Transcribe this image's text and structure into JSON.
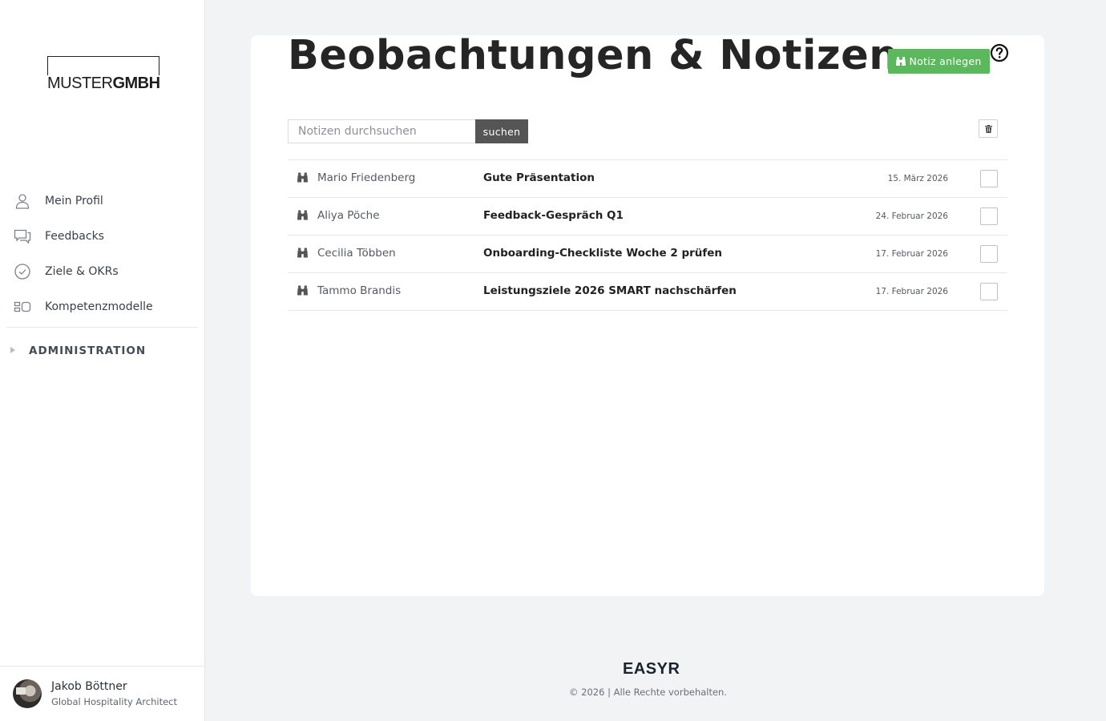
{
  "sidebar": {
    "logo": {
      "text_light": "MUSTER",
      "text_bold": "GMBH"
    },
    "items": [
      {
        "label": "Mein Profil",
        "icon": "user-icon"
      },
      {
        "label": "Feedbacks",
        "icon": "chat-bubbles-icon"
      },
      {
        "label": "Ziele & OKRs",
        "icon": "check-circle-icon"
      },
      {
        "label": "Kompetenzmodelle",
        "icon": "competency-model-icon"
      }
    ],
    "admin": {
      "label": "ADMINISTRATION",
      "icon": "caret-right-icon"
    },
    "user": {
      "name": "Jakob Böttner",
      "role": "Global Hospitality Architect"
    }
  },
  "main": {
    "title": "Beobachtungen & Notizen",
    "new_button": {
      "label": "Notiz anlegen",
      "icon": "binoculars-icon",
      "color": "#5cb85c"
    },
    "help_icon": "help-circle-icon",
    "search": {
      "placeholder": "Notizen durchsuchen",
      "value": "",
      "button_label": "suchen"
    },
    "delete_icon": "trash-icon",
    "notes": [
      {
        "author": "Mario Friedenberg",
        "title": "Gute Präsentation",
        "date": "15. März 2026",
        "checked": false
      },
      {
        "author": "Aliya Pöche",
        "title": "Feedback-Gespräch Q1",
        "date": "24. Februar 2026",
        "checked": false
      },
      {
        "author": "Cecilia Többen",
        "title": "Onboarding-Checkliste Woche 2 prüfen",
        "date": "17. Februar 2026",
        "checked": false
      },
      {
        "author": "Tammo Brandis",
        "title": "Leistungsziele 2026 SMART nachschärfen",
        "date": "17. Februar 2026",
        "checked": false
      }
    ]
  },
  "footer": {
    "brand": "EASYR",
    "copyright": "© 2026 | Alle Rechte vorbehalten."
  }
}
